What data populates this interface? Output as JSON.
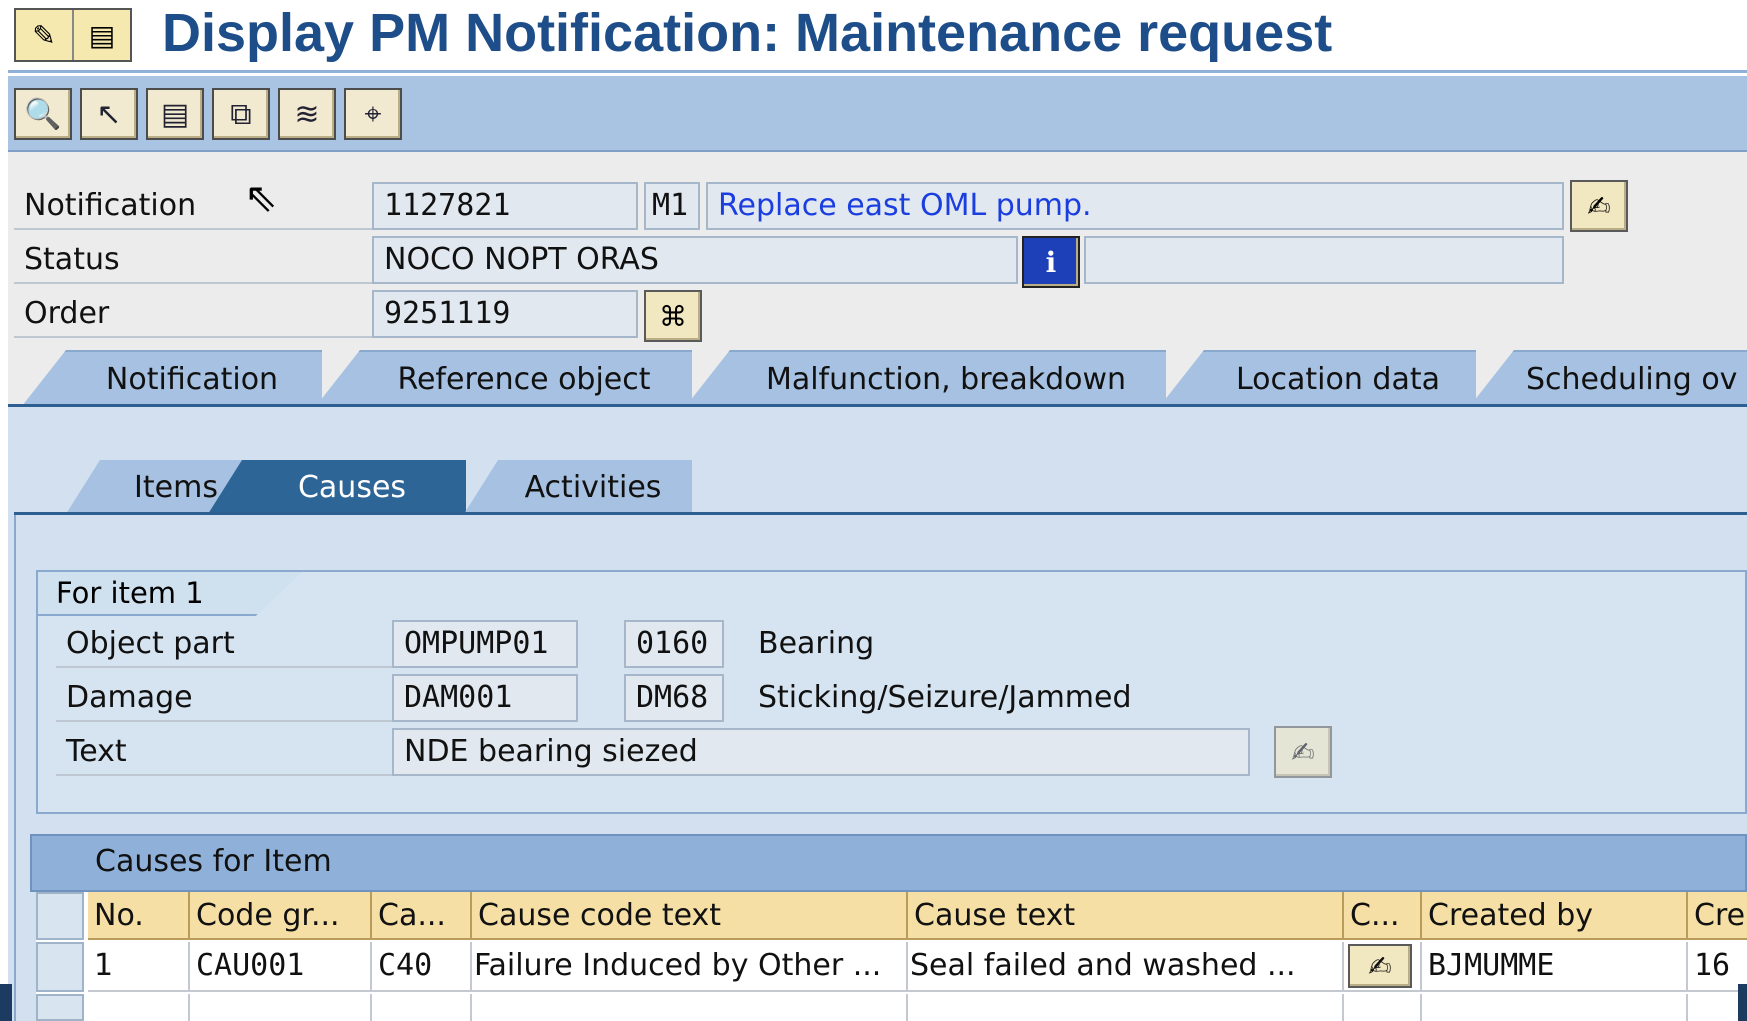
{
  "title": "Display PM Notification: Maintenance request",
  "toolbar": {
    "buttons": [
      "display-object-icon",
      "select-icon",
      "document-icon",
      "copy-icon",
      "scroll-icon",
      "binoculars-icon"
    ]
  },
  "header": {
    "notification_label": "Notification",
    "notification_number": "1127821",
    "notification_type": "M1",
    "notification_description": "Replace east OML pump.",
    "status_label": "Status",
    "status_value": "NOCO NOPT ORAS",
    "status_extra": "",
    "order_label": "Order",
    "order_value": "9251119"
  },
  "tabs": [
    {
      "label": "Notification"
    },
    {
      "label": "Reference object"
    },
    {
      "label": "Malfunction, breakdown"
    },
    {
      "label": "Location data"
    },
    {
      "label": "Scheduling ov"
    }
  ],
  "subtabs": [
    {
      "label": "Items"
    },
    {
      "label": "Causes",
      "active": true
    },
    {
      "label": "Activities"
    }
  ],
  "item": {
    "group_title": "For item    1",
    "object_part_label": "Object part",
    "object_part_group": "OMPUMP01",
    "object_part_code": "0160",
    "object_part_text": "Bearing",
    "damage_label": "Damage",
    "damage_group": "DAM001",
    "damage_code": "DM68",
    "damage_text": "Sticking/Seizure/Jammed",
    "text_label": "Text",
    "text_value": "NDE bearing siezed"
  },
  "causes_table": {
    "title": "Causes for Item",
    "columns": [
      "No.",
      "Code gr...",
      "Ca...",
      "Cause code text",
      "Cause text",
      "C...",
      "Created by",
      "Cre"
    ],
    "rows": [
      {
        "no": "1",
        "code_group": "CAU001",
        "cause_code": "C40",
        "cause_code_text": "Failure Induced by Other ...",
        "cause_text": "Seal failed and washed ...",
        "created_by": "BJMUMME",
        "created_on": "16"
      }
    ]
  },
  "colors": {
    "title": "#1e4e89",
    "toolbar": "#a9c4e2",
    "tab": "#a6c1e1",
    "active_subtab": "#2d6597",
    "table_header": "#f5dfa4",
    "description_text": "#1b3ee0"
  }
}
